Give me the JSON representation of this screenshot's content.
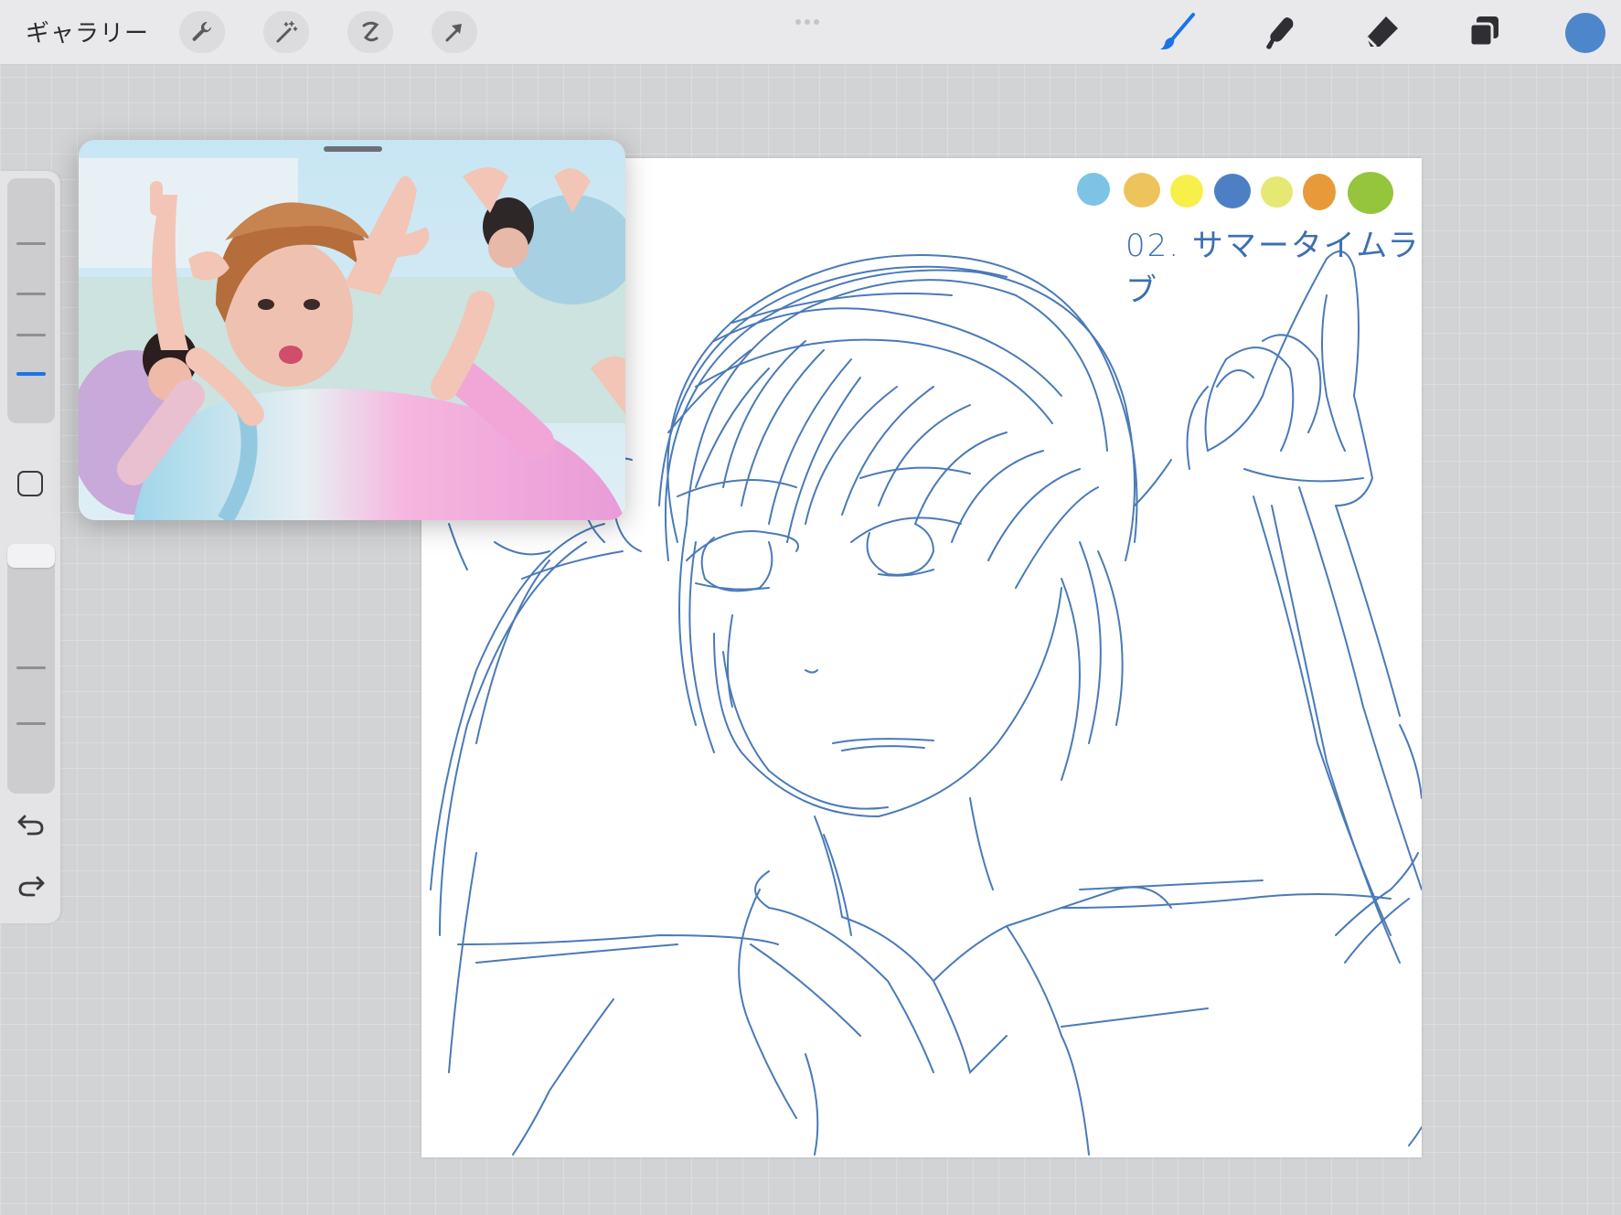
{
  "topbar": {
    "gallery_label": "ギャラリー",
    "left_tools": [
      "wrench-icon",
      "magic-wand-icon",
      "selection-icon",
      "move-arrow-icon"
    ],
    "right_tools": [
      "brush-icon",
      "smudge-icon",
      "eraser-icon",
      "layers-icon"
    ],
    "current_color": "#4d86cb"
  },
  "sidebar": {
    "brush_size_level": "low",
    "controls": [
      "brush-size-slider",
      "modify-button",
      "opacity-slider",
      "undo-button",
      "redo-button"
    ]
  },
  "canvas": {
    "palette": [
      "#7cc3e6",
      "#edc45b",
      "#f7ef4a",
      "#4d7fc4",
      "#e5e873",
      "#e89a3a",
      "#95c43d"
    ],
    "title": "02. サマータイムラブ",
    "stroke_color": "#4a7ab8"
  },
  "reference": {
    "description_icon": "reference-image"
  }
}
